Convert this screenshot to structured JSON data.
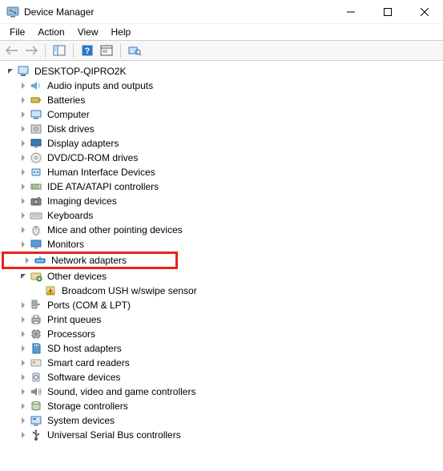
{
  "window": {
    "title": "Device Manager"
  },
  "menu": {
    "file": "File",
    "action": "Action",
    "view": "View",
    "help": "Help"
  },
  "root": {
    "name": "DESKTOP-QIPRO2K"
  },
  "nodes": [
    {
      "label": "Audio inputs and outputs",
      "icon": "audio",
      "expanded": false
    },
    {
      "label": "Batteries",
      "icon": "battery",
      "expanded": false
    },
    {
      "label": "Computer",
      "icon": "computer",
      "expanded": false
    },
    {
      "label": "Disk drives",
      "icon": "disk",
      "expanded": false
    },
    {
      "label": "Display adapters",
      "icon": "display",
      "expanded": false
    },
    {
      "label": "DVD/CD-ROM drives",
      "icon": "dvd",
      "expanded": false
    },
    {
      "label": "Human Interface Devices",
      "icon": "hid",
      "expanded": false
    },
    {
      "label": "IDE ATA/ATAPI controllers",
      "icon": "ide",
      "expanded": false
    },
    {
      "label": "Imaging devices",
      "icon": "imaging",
      "expanded": false
    },
    {
      "label": "Keyboards",
      "icon": "keyboard",
      "expanded": false
    },
    {
      "label": "Mice and other pointing devices",
      "icon": "mouse",
      "expanded": false
    },
    {
      "label": "Monitors",
      "icon": "monitor",
      "expanded": false
    },
    {
      "label": "Network adapters",
      "icon": "network",
      "expanded": false,
      "highlight": true
    },
    {
      "label": "Other devices",
      "icon": "other",
      "expanded": true,
      "children": [
        {
          "label": "Broadcom USH w/swipe sensor",
          "icon": "warn"
        }
      ]
    },
    {
      "label": "Ports (COM & LPT)",
      "icon": "ports",
      "expanded": false
    },
    {
      "label": "Print queues",
      "icon": "printer",
      "expanded": false
    },
    {
      "label": "Processors",
      "icon": "cpu",
      "expanded": false
    },
    {
      "label": "SD host adapters",
      "icon": "sd",
      "expanded": false
    },
    {
      "label": "Smart card readers",
      "icon": "smartcard",
      "expanded": false
    },
    {
      "label": "Software devices",
      "icon": "software",
      "expanded": false
    },
    {
      "label": "Sound, video and game controllers",
      "icon": "sound",
      "expanded": false
    },
    {
      "label": "Storage controllers",
      "icon": "storage",
      "expanded": false
    },
    {
      "label": "System devices",
      "icon": "system",
      "expanded": false
    },
    {
      "label": "Universal Serial Bus controllers",
      "icon": "usb",
      "expanded": false
    }
  ]
}
